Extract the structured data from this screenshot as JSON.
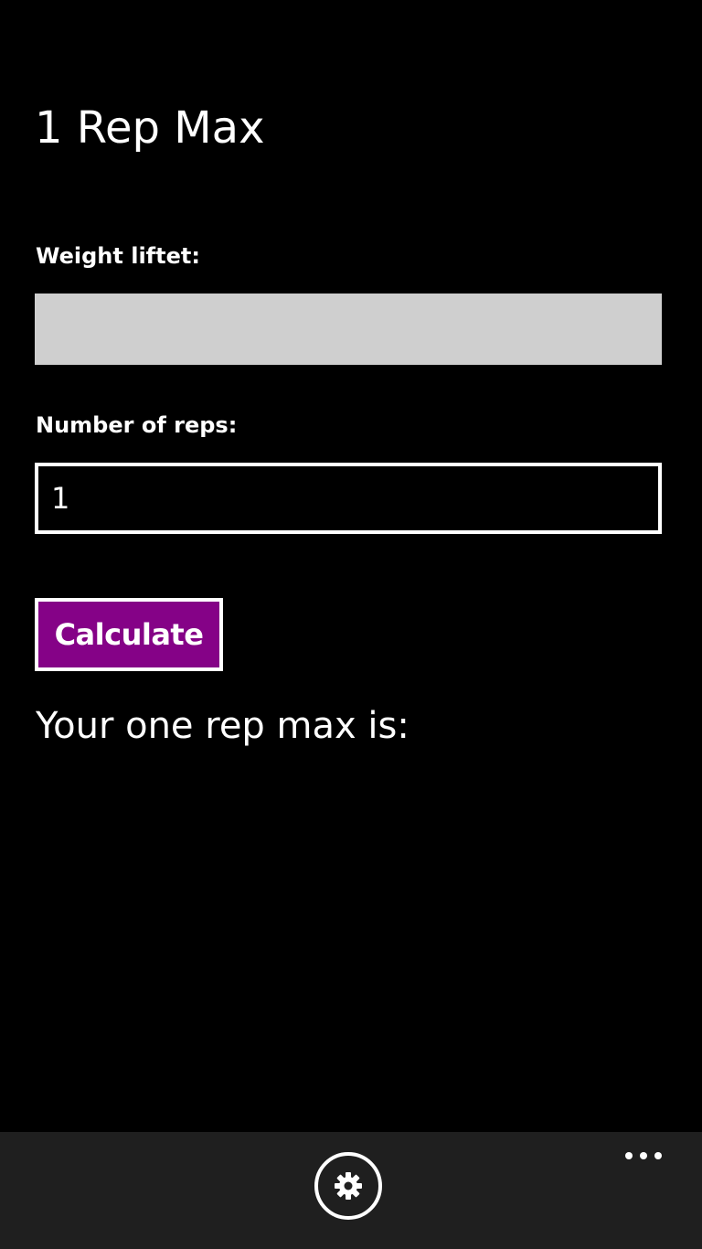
{
  "app": {
    "title": "1 Rep Max"
  },
  "form": {
    "weight_label": "Weight liftet:",
    "weight_value": "",
    "reps_label": "Number of reps:",
    "reps_value": "1",
    "calculate_label": "Calculate"
  },
  "result": {
    "text": "Your one rep max is:"
  },
  "app_bar": {
    "buttons": [
      {
        "icon": "gear-icon"
      }
    ],
    "more_icon": "ellipsis-icon"
  },
  "colors": {
    "background": "#000000",
    "accent": "#850287",
    "weight_input_bg": "#cfcfcf",
    "app_bar_bg": "#1f1f1f",
    "foreground": "#ffffff"
  }
}
